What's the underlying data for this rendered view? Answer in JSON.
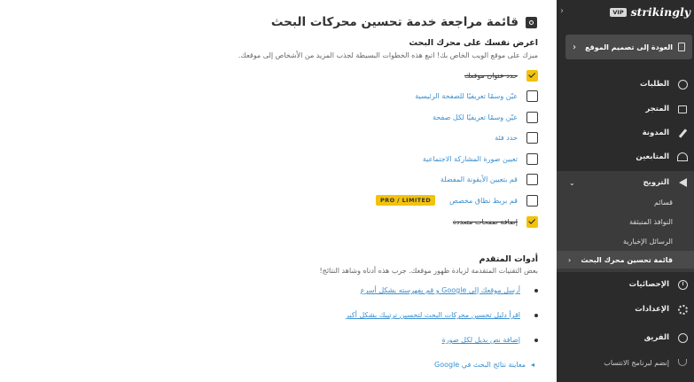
{
  "main": {
    "title": "قائمة مراجعة خدمة تحسين محركات البحث",
    "section1": {
      "title": "اعرض نفسك على محرك البحث",
      "description": "ميزك على موقع الويب الخاص بك! اتبع هذه الخطوات البسيطة لجذب المزيد من الأشخاص إلى موقعك."
    },
    "tasks": [
      {
        "label": "حدد عنوان موقعك",
        "checked": true
      },
      {
        "label": "عيّن وسمًا تعريفيًا للصفحة الرئيسية",
        "checked": false
      },
      {
        "label": "عيّن وسمًا تعريفيًا لكل صفحة",
        "checked": false
      },
      {
        "label": "حدد فئة",
        "checked": false
      },
      {
        "label": "تعيين صورة المشاركة الاجتماعية",
        "checked": false
      },
      {
        "label": "قم بتعيين الأيقونة المفضلة",
        "checked": false
      },
      {
        "label": "قم بربط نطاق مخصص",
        "checked": false
      },
      {
        "label": "إضافة صفحات متعددة",
        "checked": true
      }
    ],
    "pro_badge": "PRO / LIMITED",
    "section2": {
      "title": "أدوات المتقدم",
      "description": "بعض التقنيات المتقدمة لزيادة ظهور موقعك. جرب هذه أدناه وشاهد النتائج!"
    },
    "advanced_links": [
      "أرسل موقعك إلى Google و قم بفهرسته بشكل أسرع",
      "اقرأ دليل تحسين محركات البحث لتحسين ترتيبك بشكل أكبر",
      "إضافة نص بديل لكل صورة"
    ],
    "preview_label": "معاينة نتائج البحث في Google"
  },
  "sidebar": {
    "vip_badge": "VIP",
    "logo": "strikingly",
    "back_label": "العودة إلى تصميم الموقع",
    "items": [
      {
        "label": "الطلبات",
        "icon": "dollar-icon"
      },
      {
        "label": "المتجر",
        "icon": "store-icon"
      },
      {
        "label": "المدونة",
        "icon": "pen-icon"
      },
      {
        "label": "المتابعين",
        "icon": "people-icon"
      }
    ],
    "promo": {
      "label": "الترويج",
      "sub_items": [
        "قسائم",
        "النوافذ المنبثقة",
        "الرسائل الإخبارية"
      ],
      "active_item": "قائمة تحسين محرك البحث"
    },
    "bottom_items": [
      {
        "label": "الإحصائيات",
        "icon": "clock-icon"
      },
      {
        "label": "الإعدادات",
        "icon": "gear-icon"
      },
      {
        "label": "الفريق",
        "icon": "team-icon"
      },
      {
        "label": "إنضم لبرنامج الانتساب",
        "icon": "trophy-icon"
      }
    ]
  }
}
